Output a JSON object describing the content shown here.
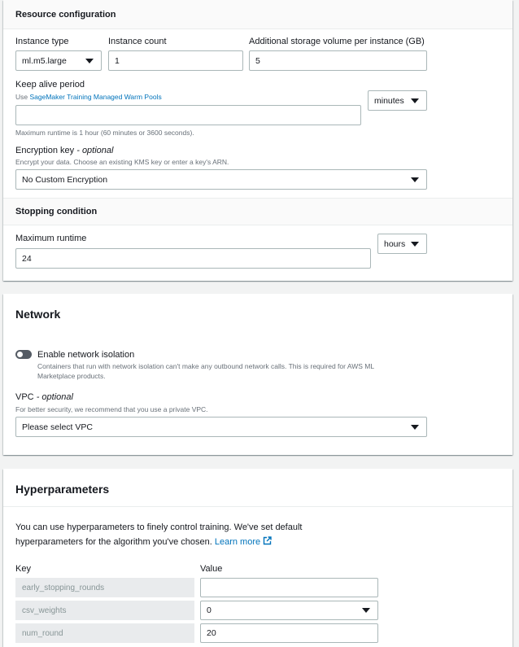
{
  "resource_configuration": {
    "title": "Resource configuration",
    "instance_type": {
      "label": "Instance type",
      "value": "ml.m5.large"
    },
    "instance_count": {
      "label": "Instance count",
      "value": "1"
    },
    "storage": {
      "label": "Additional storage volume per instance (GB)",
      "value": "5"
    },
    "keep_alive": {
      "label": "Keep alive period",
      "desc_prefix": "Use ",
      "desc_link": "SageMaker Training Managed Warm Pools",
      "value": "",
      "unit": "minutes",
      "hint": "Maximum runtime is 1 hour (60 minutes or 3600 seconds)."
    },
    "encryption": {
      "label": "Encryption key",
      "optional": "- optional",
      "desc": "Encrypt your data. Choose an existing KMS key or enter a key's ARN.",
      "value": "No Custom Encryption"
    }
  },
  "stopping_condition": {
    "title": "Stopping condition",
    "max_runtime": {
      "label": "Maximum runtime",
      "value": "24",
      "unit": "hours"
    }
  },
  "network": {
    "title": "Network",
    "isolation": {
      "label": "Enable network isolation",
      "enabled": false,
      "desc_line1": "Containers that run with network isolation can't make any outbound network calls. This is required for AWS ML",
      "desc_line2": "Marketplace products."
    },
    "vpc": {
      "label": "VPC",
      "optional": "- optional",
      "desc": "For better security, we recommend that you use a private VPC.",
      "value": "Please select VPC"
    }
  },
  "hyperparameters": {
    "title": "Hyperparameters",
    "intro_line1": "You can use hyperparameters to finely control training. We've set default",
    "intro_line2": "hyperparameters for the algorithm you've chosen.",
    "learn_more": "Learn more",
    "key_header": "Key",
    "value_header": "Value",
    "rows": [
      {
        "key": "early_stopping_rounds",
        "value": "",
        "type": "input"
      },
      {
        "key": "csv_weights",
        "value": "0",
        "type": "select"
      },
      {
        "key": "num_round",
        "value": "20",
        "type": "input"
      }
    ]
  },
  "colors": {
    "link": "#0073bb",
    "toggle_off": "#545b64",
    "border": "#aab7b8"
  }
}
